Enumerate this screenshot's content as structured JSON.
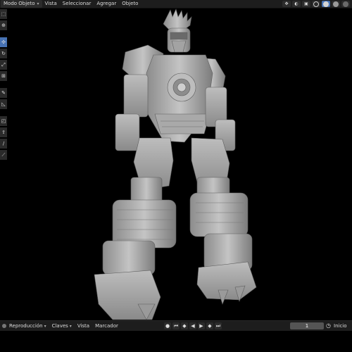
{
  "header": {
    "mode": "Modo Objeto",
    "menu": [
      "Vista",
      "Seleccionar",
      "Agregar",
      "Objeto"
    ]
  },
  "header_icons": [
    "viewport-gizmo-icon",
    "overlay-icon",
    "xray-icon",
    "wireframe-shading-icon",
    "solid-shading-icon",
    "material-shading-icon",
    "rendered-shading-icon"
  ],
  "toolbar_icons": [
    "select-box-icon",
    "cursor-icon",
    "move-icon",
    "rotate-icon",
    "scale-icon",
    "transform-icon",
    "annotate-icon",
    "measure-icon",
    "add-cube-icon",
    "extrude-icon",
    "knife-icon",
    "shear-icon"
  ],
  "timeline": {
    "playback": "Reproducción",
    "keying": "Claves",
    "view": "Vista",
    "marker": "Marcador",
    "current_frame": "1",
    "start_label": "Inicio"
  },
  "colors": {
    "accent": "#4772b3",
    "header_bg": "#1d1d1d",
    "viewport_bg": "#000000",
    "model": "#b9b9b9"
  }
}
